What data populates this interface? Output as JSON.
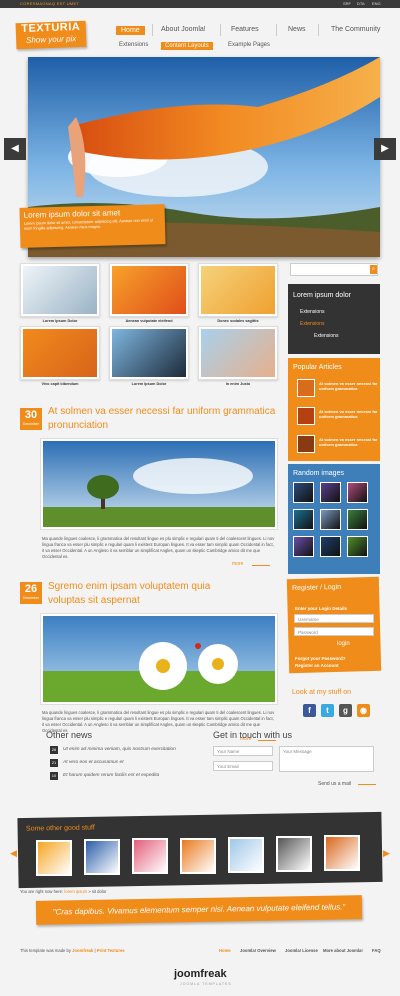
{
  "topbar": {
    "tagline": "CORESMAGNAQ EST UMET",
    "langs": [
      "SRF",
      "DTA",
      "ENG"
    ]
  },
  "logo": {
    "title": "TEXTURIA",
    "subtitle": "Show your pix"
  },
  "nav": {
    "main": [
      {
        "label": "Home",
        "active": true
      },
      {
        "label": "About Joomla!",
        "active": false
      },
      {
        "label": "Features",
        "active": false
      },
      {
        "label": "News",
        "active": false
      },
      {
        "label": "The Community",
        "active": false
      }
    ],
    "sub": [
      {
        "label": "Extensions",
        "active": false
      },
      {
        "label": "Content Layouts",
        "active": true
      },
      {
        "label": "Example Pages",
        "active": false
      }
    ]
  },
  "slider": {
    "caption_title": "Lorem ipsum dolor sit amet",
    "caption_text": "Lorem ipsum dolor sit amet, consectetuer adipiscing elit. Aenean non enim ut enim fringilla adipiscing. Aenean risus magna."
  },
  "thumbs": [
    {
      "caption": "Lorem Ipsum Dolor",
      "colors": [
        "#eef4f8",
        "#9ab3c5"
      ]
    },
    {
      "caption": "Aenean vulputate eleifend",
      "colors": [
        "#f7a22b",
        "#e04e1a"
      ]
    },
    {
      "caption": "Donec sodales sagittis",
      "colors": [
        "#f5d27a",
        "#f0a030"
      ]
    },
    {
      "caption": "Vivo capit bibendum",
      "colors": [
        "#f18a1d",
        "#d8641a"
      ]
    },
    {
      "caption": "Lorem Ipsum Dolor",
      "colors": [
        "#7fb6e0",
        "#1d2b3a"
      ]
    },
    {
      "caption": "In enim Justo",
      "colors": [
        "#a9d0ec",
        "#e6b08c"
      ]
    }
  ],
  "search": {
    "placeholder": ""
  },
  "menu_panel": {
    "title": "Lorem ipsum dolor",
    "items": [
      "Extensions",
      "Extensions",
      "Extensions"
    ]
  },
  "popular": {
    "title": "Popular Articles",
    "items": [
      {
        "text": "At solmen va esser necessi far uniform grammatica"
      },
      {
        "text": "At solmen va esser necessi far uniform grammatica"
      },
      {
        "text": "At solmen va esser necessi far uniform grammatica"
      }
    ]
  },
  "random": {
    "title": "Random images"
  },
  "login": {
    "title": "Register / Login",
    "subtitle": "Enter your Login Details",
    "username_placeholder": "Username",
    "password_placeholder": "Password",
    "button": "login",
    "forgot": "Forgot your Password?",
    "register": "Register an Account"
  },
  "social": {
    "title": "Look at my stuff on"
  },
  "articles": [
    {
      "day": "30",
      "month": "December",
      "title": "At solmen va esser necessi far uniform grammatica pronunciation",
      "text": "Ma quande lingues coalesce, li grammatica del resultant lingue es plu simplic e regulari quam ti del coalescent lingues. Li nov lingua franca va esser plu simplic e regulari quam li existent Europan lingues. It va esser tam simplic quam Occidental in fact, it va esser Occidental. A un Angleso it va semblar un simplificat Angles, quam un skeptic Cambridge amico dit me que Occidental es.",
      "more": "more"
    },
    {
      "day": "26",
      "month": "December",
      "title": "Sgremo enim ipsam voluptatem quia voluptas sit aspernat",
      "text": "Ma quande lingues coalesce, li grammatica del resultant lingue es plu simplic e regulari quam ti del coalescent lingues. Li nov lingua franca va esser plu simplic e regulari quam li existent Europan lingues. It va esser tam simplic quam Occidental in fact, it va esser Occidental. A un Angleso it va semblar un simplificat Angles, quam un skeptic Cambridge amico dit me que Occidental es.",
      "more": "more"
    }
  ],
  "other_news": {
    "title": "Other news",
    "items": [
      {
        "num": "26",
        "text": "Ut enim ad minima veniam, quis nostrum exercitation"
      },
      {
        "num": "21",
        "text": "At vero eos et accusamus et"
      },
      {
        "num": "10",
        "text": "Et harum quidem rerum facilis est et expedita"
      }
    ]
  },
  "contact": {
    "title": "Get in touch with us",
    "name_placeholder": "Your Name",
    "email_placeholder": "Your Email",
    "message_placeholder": "Your Message",
    "send": "Send us a mail"
  },
  "good_stuff": {
    "title": "Some other good stuff"
  },
  "breadcrumb": {
    "prefix": "You are right now here:",
    "link": "lorem ipsum",
    "current": "sit dolor"
  },
  "quote": {
    "text": "\"Cras dapibus. Vivamus elementum semper nisi. Aenean vulputate eleifend tellus.\""
  },
  "footer": {
    "credit_prefix": "This template was made by",
    "credit_link": "Joomfreak",
    "credit_link2": "Print Textures",
    "links": [
      "Home",
      "Joomla! Overview",
      "Joomla! License",
      "More about Joomla!",
      "FAQ"
    ],
    "brand": "joomfreak",
    "brand_sub": "JOOMLA TEMPLATES"
  },
  "colors": {
    "accent": "#f08c1a",
    "dark": "#333333",
    "blue": "#3f7fb9"
  }
}
